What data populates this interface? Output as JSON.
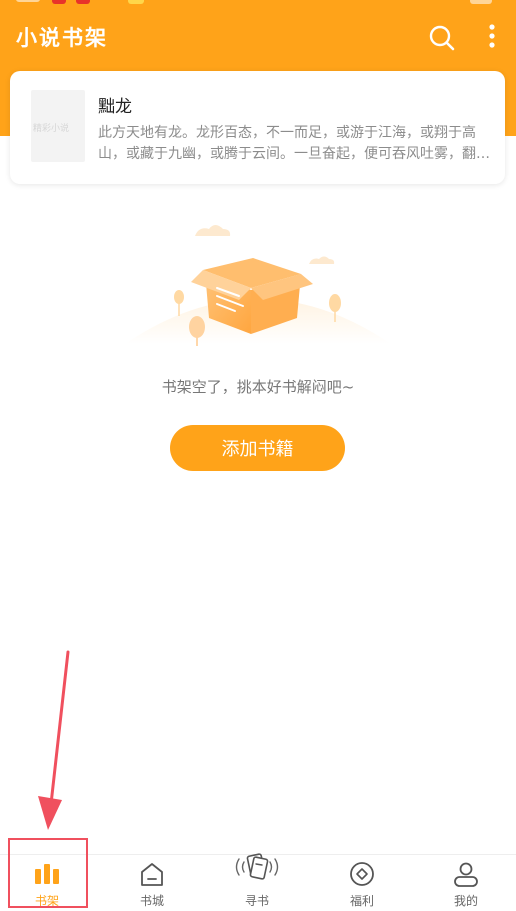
{
  "header": {
    "title": "小说书架",
    "search_icon": "search-icon",
    "more_icon": "more-vertical-icon",
    "accent_color": "#ffa319"
  },
  "book": {
    "title": "黜龙",
    "cover_text": "精彩小说",
    "description": "此方天地有龙。龙形百态，不一而足，或游于江海，或翔于高山，或藏于九幽，或腾于云间。一旦奋起，便可吞风吐雾，翻江倒海。"
  },
  "empty_state": {
    "illustration": "open-box-illustration",
    "message": "书架空了，挑本好书解闷吧~",
    "button_label": "添加书籍"
  },
  "tabs": [
    {
      "label": "书架",
      "icon": "bookshelf-icon",
      "active": true
    },
    {
      "label": "书城",
      "icon": "store-icon",
      "active": false
    },
    {
      "label": "寻书",
      "icon": "find-book-icon",
      "active": false
    },
    {
      "label": "福利",
      "icon": "coin-icon",
      "active": false
    },
    {
      "label": "我的",
      "icon": "person-icon",
      "active": false
    }
  ],
  "annotation_color": "#f0505e"
}
